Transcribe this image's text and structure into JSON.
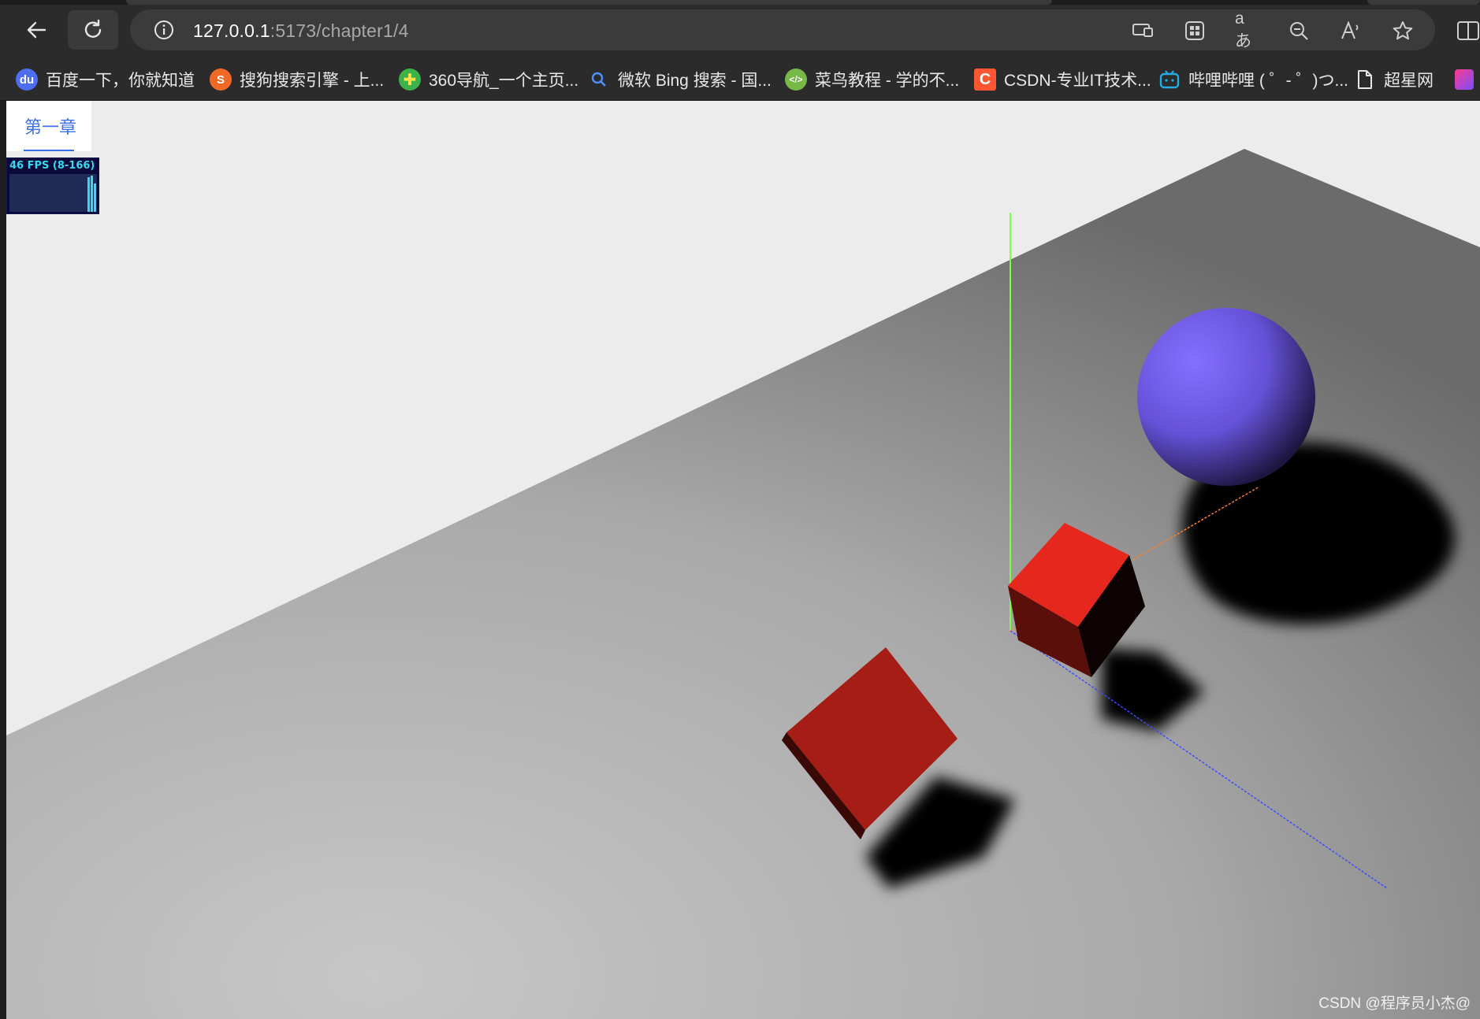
{
  "browser": {
    "url_host": "127.0.0.1",
    "url_path": ":5173/chapter1/4",
    "toolbar_icons": [
      "back-icon",
      "reload-icon",
      "info-icon",
      "cast-icon",
      "apps-icon",
      "translate-icon",
      "zoom-out-icon",
      "read-aloud-icon",
      "favorite-star-icon",
      "split-screen-icon"
    ]
  },
  "bookmarks": [
    {
      "label": "百度一下，你就知道",
      "icon": "baidu-icon",
      "color": "#4e6ef2"
    },
    {
      "label": "搜狗搜索引擎 - 上...",
      "icon": "sogou-icon",
      "color": "#f06a26"
    },
    {
      "label": "360导航_一个主页...",
      "icon": "360-icon",
      "color": "#3bb34a"
    },
    {
      "label": "微软 Bing 搜索 - 国...",
      "icon": "bing-search-icon",
      "color": "#4a90ff"
    },
    {
      "label": "菜鸟教程 - 学的不...",
      "icon": "runoob-icon",
      "color": "#76b947"
    },
    {
      "label": "CSDN-专业IT技术...",
      "icon": "csdn-icon",
      "color": "#fc5531"
    },
    {
      "label": "哔哩哔哩 ( ゜- ゜)つ...",
      "icon": "bilibili-icon",
      "color": "#23ade5"
    },
    {
      "label": "超星网",
      "icon": "page-icon",
      "color": "#e8e8e8"
    }
  ],
  "page": {
    "tab_label": "第一章",
    "fps_text": "46 FPS (8-166)",
    "watermark": "CSDN @程序员小杰@"
  },
  "scene": {
    "sphere_color": "#7b68ee",
    "cube_color": "#e5271d",
    "plane_color": "#a8a8a8",
    "axis_colors": {
      "x": "#ff7f2a",
      "y": "#7cff3c",
      "z": "#3b4bff"
    }
  }
}
